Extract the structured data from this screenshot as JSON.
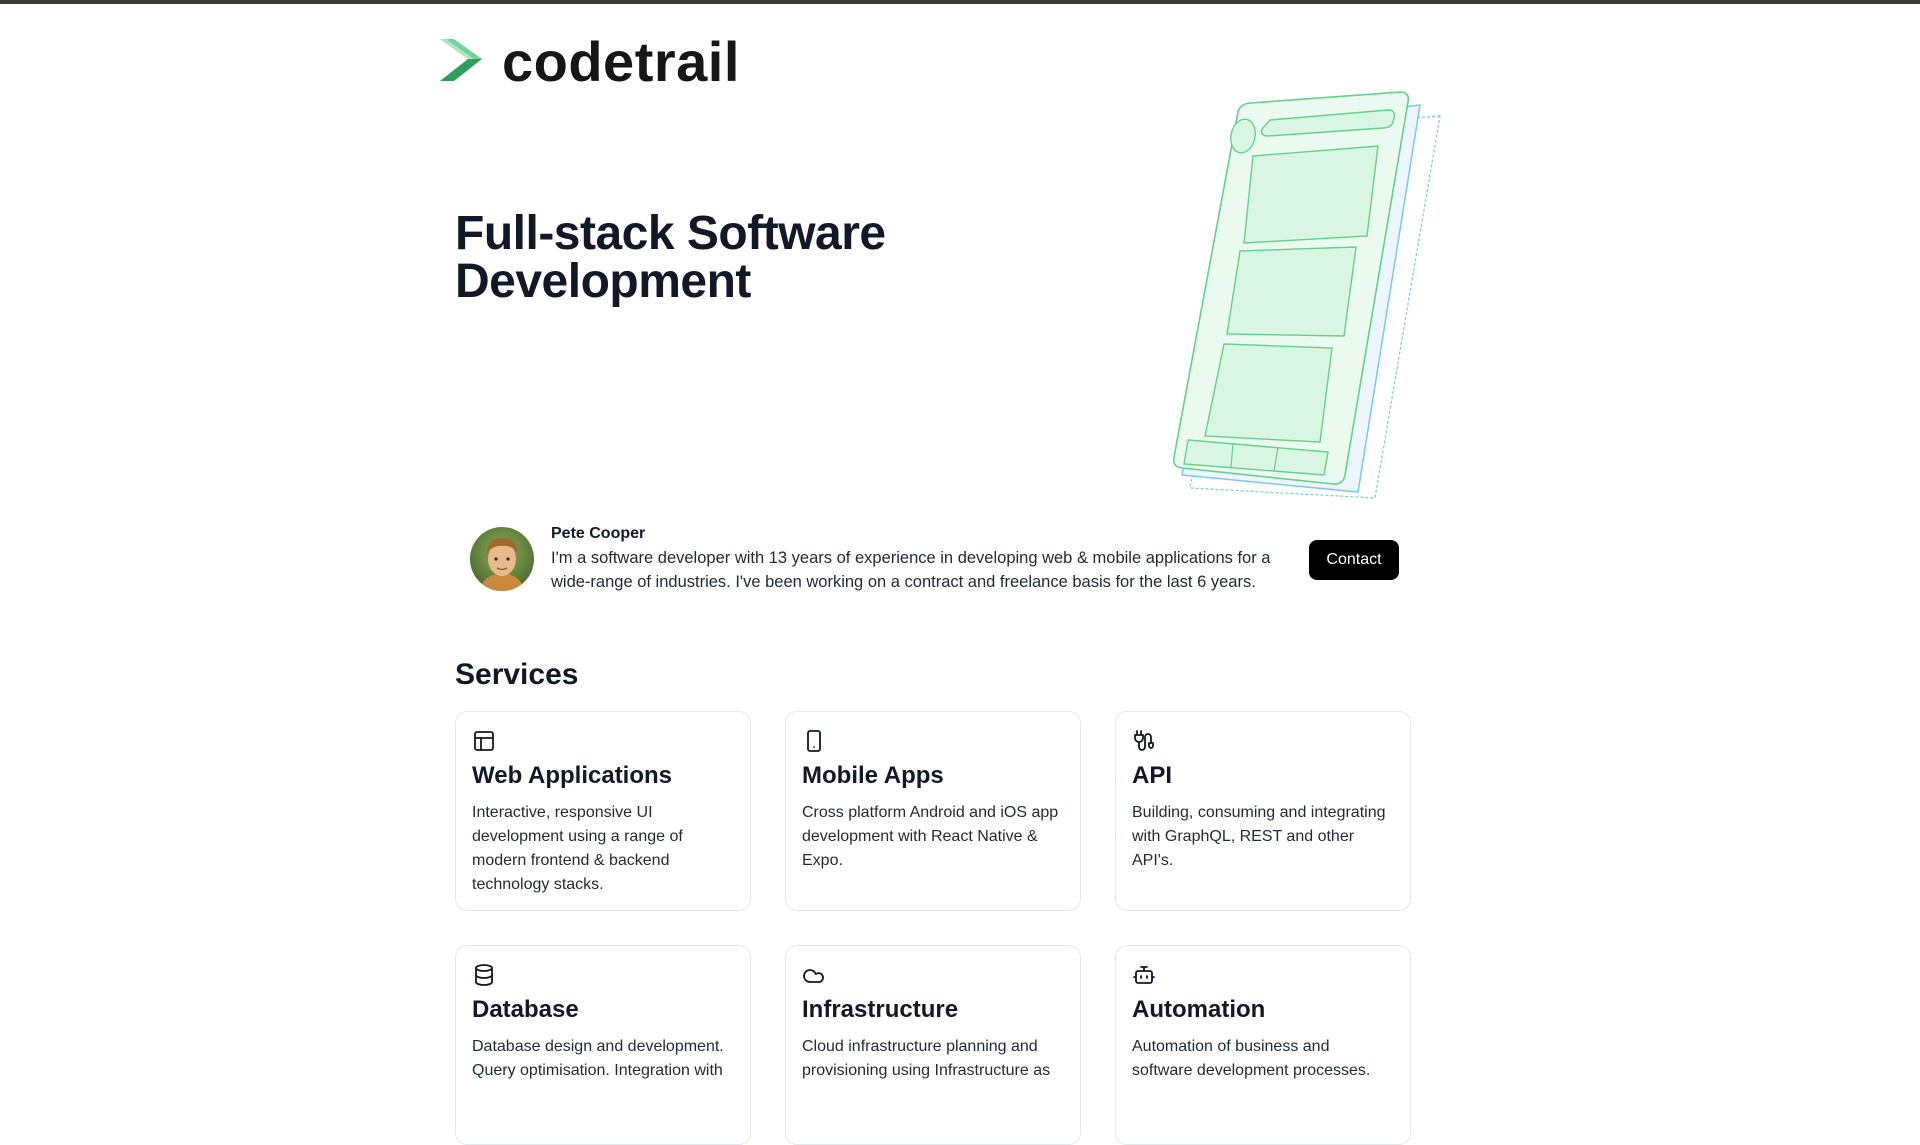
{
  "brand": {
    "name": "codetrail",
    "accent": "#3fbf74",
    "accent_dark": "#2e8f57"
  },
  "hero": {
    "title": "Full-stack Software Development"
  },
  "profile": {
    "name": "Pete Cooper",
    "bio": "I'm a software developer with 13 years of experience in developing web & mobile applications for a wide-range of industries. I've been working on a contract and freelance basis for the last 6 years.",
    "contact_label": "Contact"
  },
  "services": {
    "heading": "Services",
    "items": [
      {
        "icon": "layout-icon",
        "title": "Web Applications",
        "description": "Interactive, responsive UI development using a range of modern frontend & backend technology stacks."
      },
      {
        "icon": "smartphone-icon",
        "title": "Mobile Apps",
        "description": "Cross platform Android and iOS app development with React Native & Expo."
      },
      {
        "icon": "plug-icon",
        "title": "API",
        "description": "Building, consuming and integrating with GraphQL, REST and other API's."
      },
      {
        "icon": "database-icon",
        "title": "Database",
        "description": "Database design and development. Query optimisation. Integration with"
      },
      {
        "icon": "cloud-icon",
        "title": "Infrastructure",
        "description": "Cloud infrastructure planning and provisioning using Infrastructure as"
      },
      {
        "icon": "bot-icon",
        "title": "Automation",
        "description": "Automation of business and software development processes."
      }
    ]
  },
  "colors": {
    "top_bar": "#3f3a33",
    "button_bg": "#000000",
    "card_border": "#e5e7eb"
  }
}
